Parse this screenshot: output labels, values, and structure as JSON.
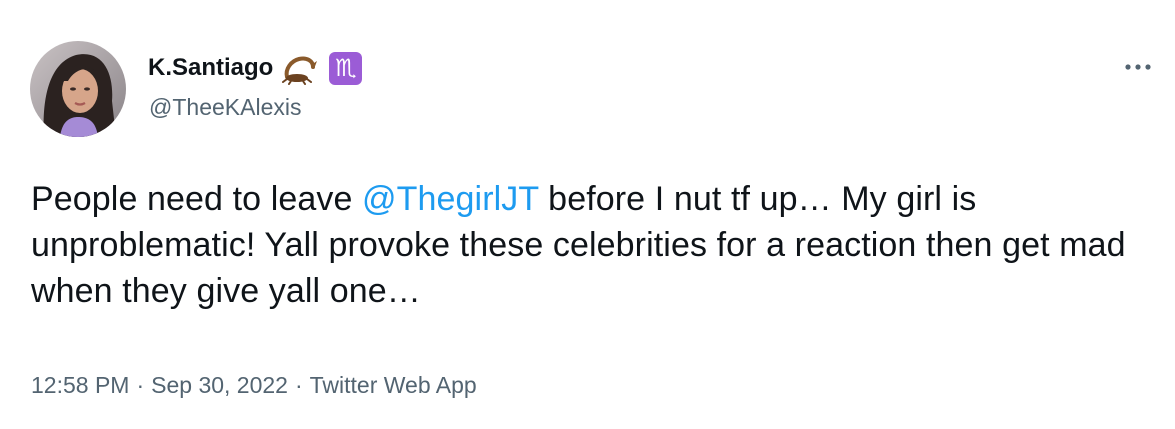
{
  "author": {
    "display_name": "K.Santiago",
    "handle": "@TheeKAlexis",
    "name_emojis": [
      "scorpion-emoji",
      "scorpius-emoji"
    ],
    "scorpius_glyph": "♏"
  },
  "tweet": {
    "text_before": "People need to leave ",
    "mention": "@ThegirlJT",
    "text_after": " before I nut tf up… My girl is unproblematic! Yall provoke these celebrities for a reaction then get mad when they give yall one…"
  },
  "meta": {
    "time": "12:58 PM",
    "separator": "·",
    "date": "Sep 30, 2022",
    "source": "Twitter Web App"
  },
  "colors": {
    "text": "#0f1419",
    "secondary": "#536471",
    "link": "#1d9bf0",
    "scorpius_badge": "#9b5cd6"
  },
  "icons": {
    "more": "more-dots-icon"
  }
}
